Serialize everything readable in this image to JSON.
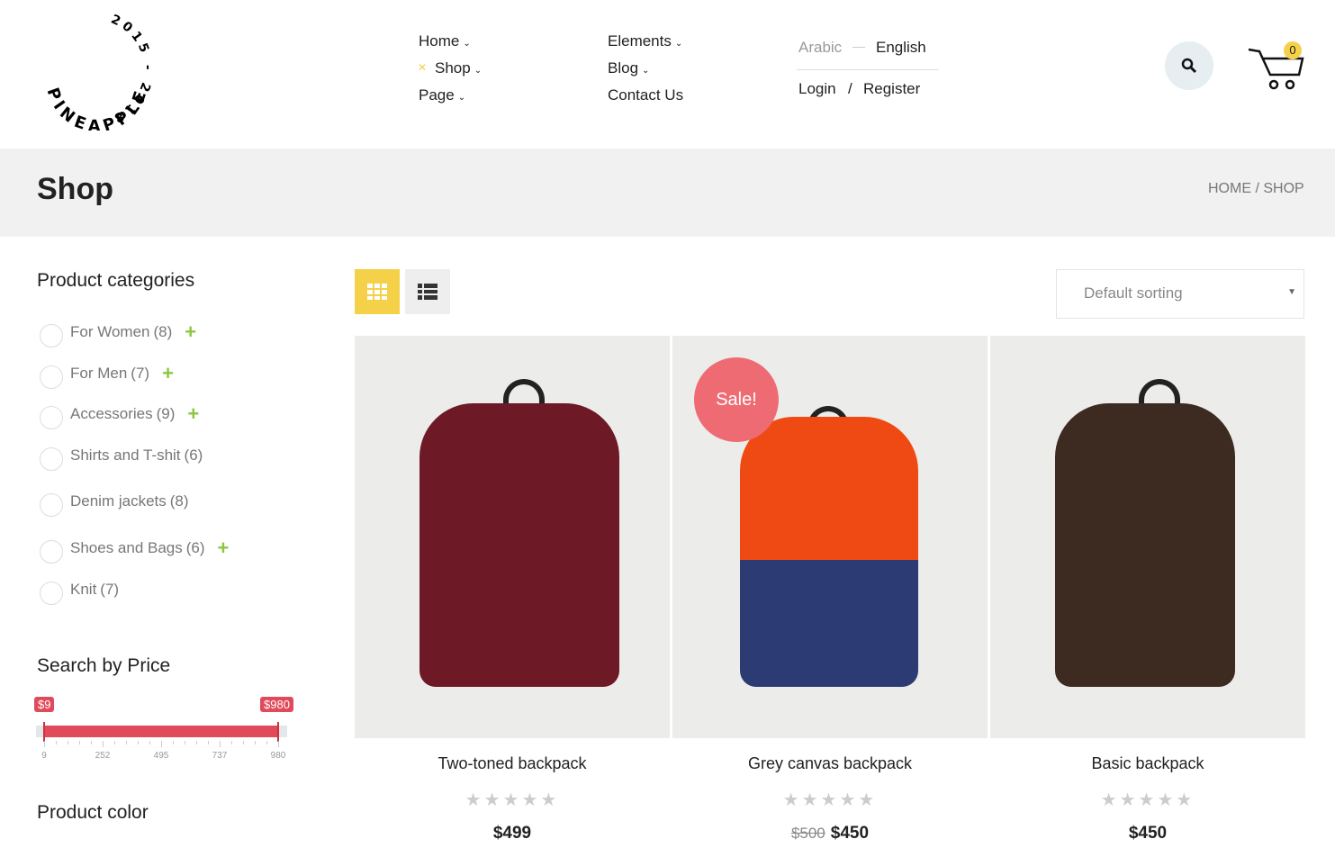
{
  "logo": {
    "text": "PINEAPPLE",
    "years": "2015 - 2018"
  },
  "nav": {
    "col1": [
      {
        "label": "Home"
      },
      {
        "label": "Shop",
        "active": true
      },
      {
        "label": "Page"
      }
    ],
    "col2": [
      {
        "label": "Elements"
      },
      {
        "label": "Blog"
      },
      {
        "label": "Contact Us"
      }
    ]
  },
  "lang": {
    "arabic": "Arabic",
    "english": "English"
  },
  "account": {
    "login": "Login",
    "sep": "/",
    "register": "Register"
  },
  "cart": {
    "count": "0"
  },
  "page": {
    "title": "Shop",
    "breadcrumb": "HOME / SHOP"
  },
  "sidebar": {
    "categories_title": "Product categories",
    "categories": [
      {
        "label": "For Women",
        "count": "(8)",
        "expandable": true
      },
      {
        "label": "For Men",
        "count": "(7)",
        "expandable": true
      },
      {
        "label": "Accessories",
        "count": "(9)",
        "expandable": true
      },
      {
        "label": "Shirts and T-shit",
        "count": "(6)",
        "expandable": false
      },
      {
        "label": "Denim jackets",
        "count": "(8)",
        "expandable": false
      },
      {
        "label": "Shoes and Bags",
        "count": "(6)",
        "expandable": true
      },
      {
        "label": "Knit",
        "count": "(7)",
        "expandable": false
      }
    ],
    "price_title": "Search by Price",
    "price": {
      "min_label": "$9",
      "max_label": "$980",
      "ticks": [
        "9",
        "252",
        "495",
        "737",
        "980"
      ]
    },
    "color_title": "Product color"
  },
  "toolbar": {
    "sorting": "Default sorting"
  },
  "products": [
    {
      "name": "Two-toned backpack",
      "price": "$499",
      "old_price": "",
      "sale": "",
      "color": "#6e1a26"
    },
    {
      "name": "Grey canvas backpack",
      "price": "$450",
      "old_price": "$500",
      "sale": "Sale!",
      "color": "#f04a14"
    },
    {
      "name": "Basic backpack",
      "price": "$450",
      "old_price": "",
      "sale": "",
      "color": "#3d2a20"
    }
  ],
  "colors": {
    "accent": "#f5d14a",
    "sale": "#ef6b73",
    "slider": "#e04a5a"
  }
}
